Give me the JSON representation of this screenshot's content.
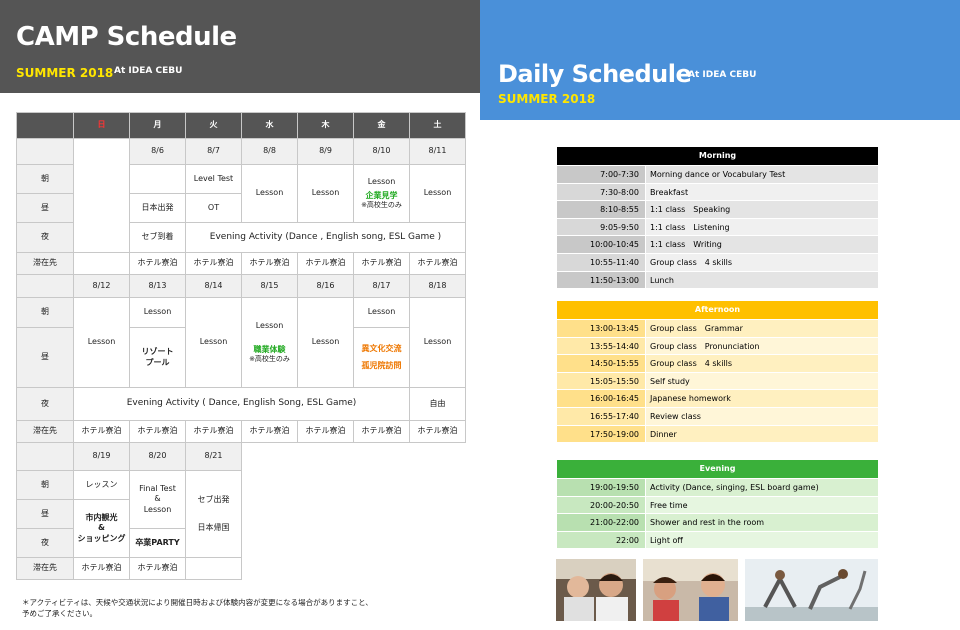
{
  "left_header": {
    "title": "CAMP Schedule",
    "sub": "SUMMER 2018",
    "sub2": "At IDEA CEBU"
  },
  "right_header": {
    "title": "Daily Schedule",
    "sub": "SUMMER 2018",
    "sub2": "At IDEA CEBU"
  },
  "week_header": [
    "日",
    "月",
    "火",
    "水",
    "木",
    "金",
    "土"
  ],
  "rows": {
    "asa": "朝",
    "hiru": "昼",
    "yoru": "夜",
    "stay": "滞在先"
  },
  "w1": {
    "dates": [
      "8/6",
      "8/7",
      "8/8",
      "8/9",
      "8/10",
      "8/11"
    ],
    "mon_hiru": "日本出発",
    "mon_yoru": "セブ到着",
    "tue_asa": "Level Test",
    "tue_hiru": "OT",
    "wed": "Lesson",
    "thu": "Lesson",
    "fri_lesson": "Lesson",
    "fri_act": "企業見学",
    "fri_note": "※高校生のみ",
    "sat": "Lesson",
    "evening": "Evening Activity (Dance , English song, ESL Game )"
  },
  "w2": {
    "dates": [
      "8/12",
      "8/13",
      "8/14",
      "8/15",
      "8/16",
      "8/17",
      "8/18"
    ],
    "sun": "Lesson",
    "mon_lesson": "Lesson",
    "mon_act": "リゾート\nプール",
    "tue": "Lesson",
    "wed_lesson": "Lesson",
    "wed_act": "職業体験",
    "wed_note": "※高校生のみ",
    "thu": "Lesson",
    "fri_lesson": "Lesson",
    "fri_act1": "異文化交流",
    "fri_act2": "孤児院訪問",
    "sat": "Lesson",
    "evening": "Evening Activity ( Dance, English Song, ESL Game)",
    "sat_yoru": "自由"
  },
  "w3": {
    "dates": [
      "8/19",
      "8/20",
      "8/21"
    ],
    "sun_asa": "レッスン",
    "sun_act": "市内観光\n&\nショッピング",
    "mon_a": "Final Test",
    "mon_b": "&",
    "mon_c": "Lesson",
    "mon_party": "卒業PARTY",
    "tue_a": "セブ出発",
    "tue_b": "日本帰国"
  },
  "stay": "ホテル寮泊",
  "footnote": [
    "＊アクティビティは、天候や交通状況により開催日時および体験内容が変更になる場合がありますこと、",
    "予めご了承ください。"
  ],
  "daily": {
    "morning": {
      "title": "Morning",
      "color": "#000000",
      "items": [
        {
          "time": "7:00-7:30",
          "act": "Morning dance or Vocabulary Test"
        },
        {
          "time": "7:30-8:00",
          "act": "Breakfast"
        },
        {
          "time": "8:10-8:55",
          "act": "1:1 class　Speaking"
        },
        {
          "time": "9:05-9:50",
          "act": "1:1 class　Listening"
        },
        {
          "time": "10:00-10:45",
          "act": "1:1 class　Writing"
        },
        {
          "time": "10:55-11:40",
          "act": "Group class　4 skills"
        },
        {
          "time": "11:50-13:00",
          "act": "Lunch"
        }
      ]
    },
    "afternoon": {
      "title": "Afternoon",
      "color": "#ffc000",
      "items": [
        {
          "time": "13:00-13:45",
          "act": "Group class　Grammar"
        },
        {
          "time": "13:55-14:40",
          "act": "Group class　Pronunciation"
        },
        {
          "time": "14:50-15:55",
          "act": "Group class　4 skills"
        },
        {
          "time": "15:05-15:50",
          "act": "Self study"
        },
        {
          "time": "16:00-16:45",
          "act": "Japanese homework"
        },
        {
          "time": "16:55-17:40",
          "act": "Review class"
        },
        {
          "time": "17:50-19:00",
          "act": "Dinner"
        }
      ]
    },
    "evening": {
      "title": "Evening",
      "color": "#3ab03a",
      "items": [
        {
          "time": "19:00-19:50",
          "act": "Activity  (Dance, singing, ESL board game)"
        },
        {
          "time": "20:00-20:50",
          "act": "Free time"
        },
        {
          "time": "21:00-22:00",
          "act": "Shower and rest in the room"
        },
        {
          "time": "22:00",
          "act": "Light off"
        }
      ]
    }
  }
}
